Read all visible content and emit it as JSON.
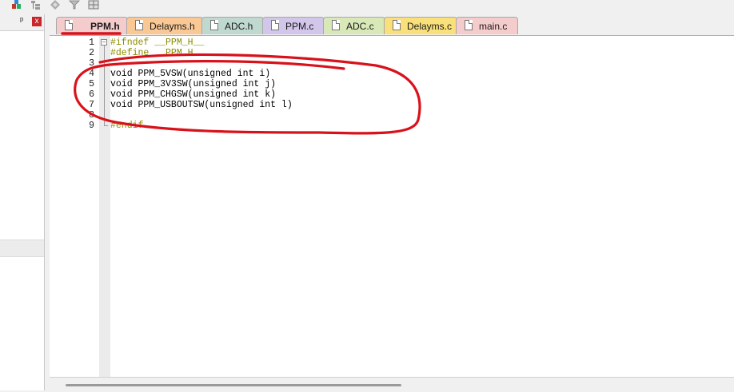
{
  "toolbar": {
    "icons": [
      "project-icon",
      "tree-icon",
      "diamond-icon",
      "funnel-icon",
      "grid-icon"
    ]
  },
  "left_panel": {
    "pin_glyph": "ᵖ",
    "close_glyph": "x"
  },
  "tabs": [
    {
      "label": "PPM.h",
      "color": "#f5cccc",
      "active": true
    },
    {
      "label": "Delayms.h",
      "color": "#f9c894"
    },
    {
      "label": "ADC.h",
      "color": "#bfd9cf"
    },
    {
      "label": "PPM.c",
      "color": "#d2c6ea"
    },
    {
      "label": "ADC.c",
      "color": "#d8e8b7"
    },
    {
      "label": "Delayms.c",
      "color": "#f9e07a"
    },
    {
      "label": "main.c",
      "color": "#f5cccc"
    }
  ],
  "editor": {
    "lines": [
      {
        "n": "1",
        "text": "#ifndef __PPM_H__"
      },
      {
        "n": "2",
        "text": "#define __PPM_H"
      },
      {
        "n": "3",
        "text": ""
      },
      {
        "n": "4",
        "text": "void PPM_5VSW(unsigned int i)"
      },
      {
        "n": "5",
        "text": "void PPM_3V3SW(unsigned int j)"
      },
      {
        "n": "6",
        "text": "void PPM_CHGSW(unsigned int k)"
      },
      {
        "n": "7",
        "text": "void PPM_USBOUTSW(unsigned int l)"
      },
      {
        "n": "8",
        "text": ""
      },
      {
        "n": "9",
        "text": "#endif"
      }
    ]
  },
  "annotation_color": "#d8121b"
}
